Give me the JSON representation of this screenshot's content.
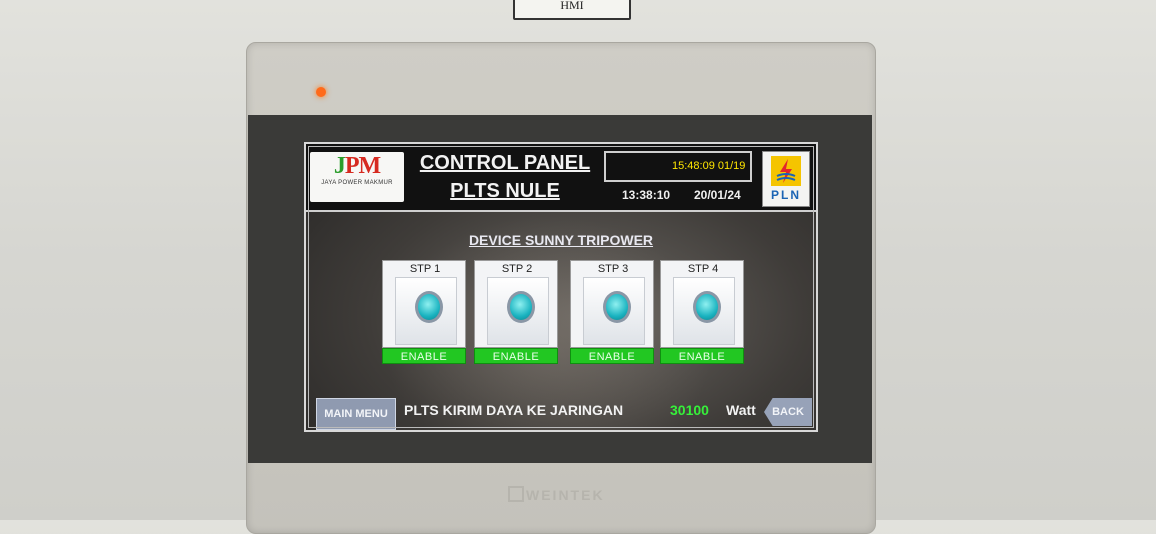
{
  "wall_tag": "HMI",
  "brand": "WEINTEK",
  "header": {
    "logo_left": {
      "mark_a": "J",
      "mark_b": "P",
      "mark_c": "M",
      "text": "JAYA POWER MAKMUR"
    },
    "title_line1": "CONTROL PANEL",
    "title_line2": "PLTS NULE",
    "clock_box_text": "15:48:09  01/19",
    "time": "13:38:10",
    "date": "20/01/24",
    "logo_right": {
      "text": "PLN"
    }
  },
  "section_title": "DEVICE SUNNY TRIPOWER",
  "devices": [
    {
      "name": "STP 1",
      "status": "ENABLE"
    },
    {
      "name": "STP 2",
      "status": "ENABLE"
    },
    {
      "name": "STP 3",
      "status": "ENABLE"
    },
    {
      "name": "STP 4",
      "status": "ENABLE"
    }
  ],
  "footer": {
    "main_menu_label": "MAIN MENU",
    "status_label": "PLTS KIRIM DAYA KE JARINGAN",
    "power_value": "30100",
    "power_unit": "Watt",
    "back_label": "BACK"
  },
  "colors": {
    "enable_green": "#22c722",
    "value_green": "#36f03a",
    "clock_yellow": "#ffe600",
    "pln_blue": "#1b64b4",
    "pln_yellow": "#f5c400",
    "led_orange": "#ff6a1a"
  }
}
